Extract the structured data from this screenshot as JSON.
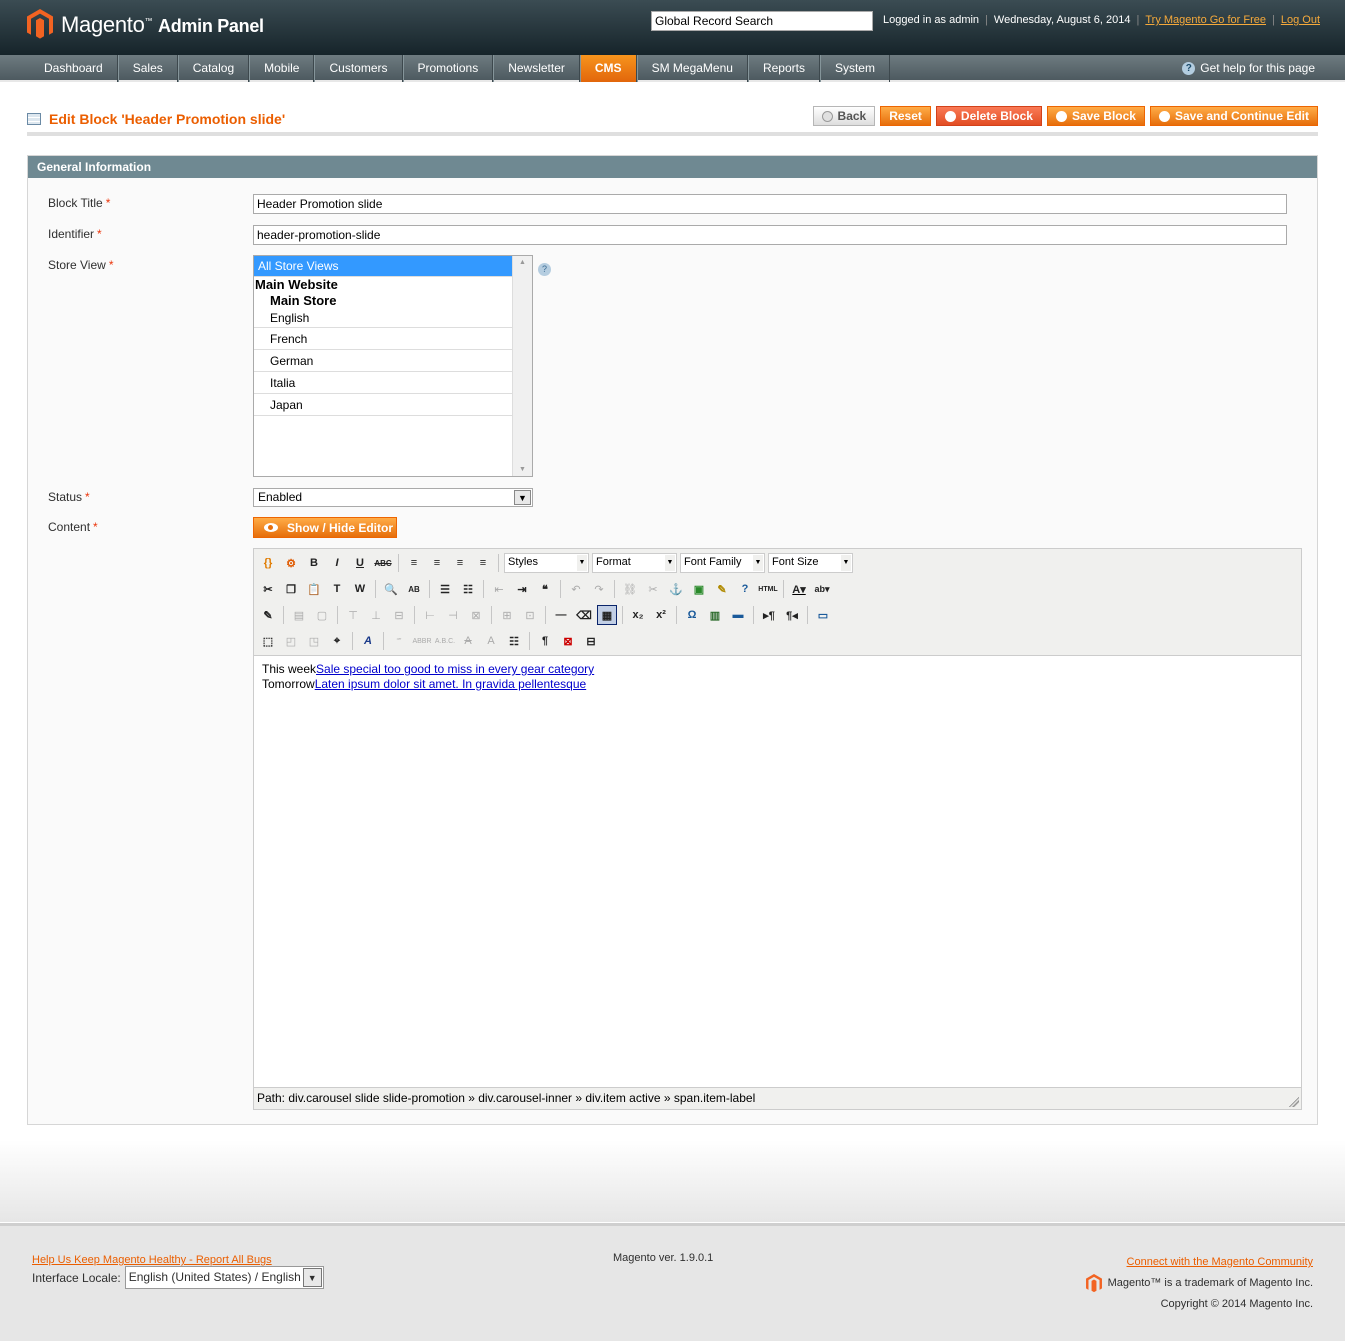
{
  "header": {
    "logo_main": "Magento",
    "logo_sub": "Admin Panel",
    "search_value": "Global Record Search",
    "logged_in": "Logged in as admin",
    "date": "Wednesday, August 6, 2014",
    "try_link": "Try Magento Go for Free",
    "logout": "Log Out"
  },
  "nav": {
    "items": [
      "Dashboard",
      "Sales",
      "Catalog",
      "Mobile",
      "Customers",
      "Promotions",
      "Newsletter",
      "CMS",
      "SM MegaMenu",
      "Reports",
      "System"
    ],
    "active": "CMS",
    "help": "Get help for this page"
  },
  "page": {
    "title": "Edit Block 'Header Promotion slide'",
    "buttons": {
      "back": "Back",
      "reset": "Reset",
      "delete": "Delete Block",
      "save": "Save Block",
      "save_continue": "Save and Continue Edit"
    }
  },
  "form": {
    "section_title": "General Information",
    "block_title_label": "Block Title",
    "block_title_value": "Header Promotion slide",
    "identifier_label": "Identifier",
    "identifier_value": "header-promotion-slide",
    "store_view_label": "Store View",
    "store_views": {
      "selected": "All Store Views",
      "website": "Main Website",
      "store": "Main Store",
      "views": [
        "English",
        "French",
        "German",
        "Italia",
        "Japan"
      ]
    },
    "status_label": "Status",
    "status_value": "Enabled",
    "content_label": "Content",
    "show_hide": "Show / Hide Editor",
    "required_mark": "*"
  },
  "editor": {
    "dropdowns": {
      "styles": "Styles",
      "format": "Format",
      "font_family": "Font Family",
      "font_size": "Font Size"
    },
    "content": {
      "line1_prefix": "This week",
      "line1_link": "Sale special too good to miss in every gear category",
      "line2_prefix": "Tomorrow",
      "line2_link": "Laten ipsum dolor sit amet. In gravida pellentesque"
    },
    "path": "Path: div.carousel slide slide-promotion » div.carousel-inner » div.item active » span.item-label"
  },
  "footer": {
    "report_link": "Help Us Keep Magento Healthy - Report All Bugs",
    "locale_label": "Interface Locale:",
    "locale_value": "English (United States) / English",
    "version": "Magento ver. 1.9.0.1",
    "community_link": "Connect with the Magento Community",
    "trademark": "Magento™ is a trademark of Magento Inc.",
    "copyright": "Copyright © 2014 Magento Inc."
  },
  "colors": {
    "accent": "#eb5e00",
    "nav_active": "#f7941d",
    "section_head": "#6f8992",
    "delete": "#e24d23"
  }
}
